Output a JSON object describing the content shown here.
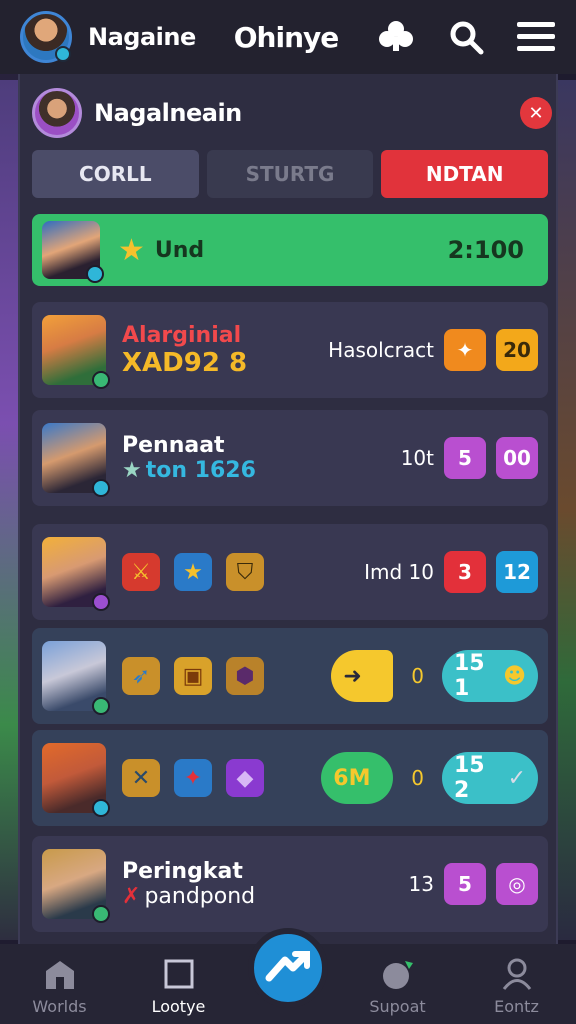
{
  "topbar": {
    "user_name": "Nagaine",
    "brand": "Ohinye",
    "icons": [
      "club-icon",
      "search-icon",
      "menu-icon"
    ]
  },
  "panel": {
    "title": "Nagalneain",
    "close_icon": "close-icon",
    "tabs": [
      {
        "label": "CORLL"
      },
      {
        "label": "STURTG"
      },
      {
        "label": "NDTAN"
      }
    ],
    "banner": {
      "label": "Und",
      "score": "2:100",
      "icon": "star-icon"
    },
    "rows": [
      {
        "title": "Alarginial",
        "subtitle": "XAD92 8",
        "side_label": "Hasolcract",
        "chips": [
          "✦",
          "20"
        ],
        "chip_colors": [
          "#f08a1e",
          "#f3a81a"
        ]
      },
      {
        "title": "Pennaat",
        "subtitle": "ton 1626",
        "side_label": "10t",
        "chips": [
          "5",
          "00"
        ],
        "chip_colors": [
          "#b94fd0",
          "#b94fd0"
        ]
      },
      {
        "side_label": "Imd 10",
        "chips": [
          "3",
          "12"
        ],
        "chip_colors": [
          "#e3303a",
          "#1e9ad8"
        ],
        "items": [
          "sword-icon",
          "star-icon",
          "shield-icon"
        ]
      },
      {
        "side_label": "0",
        "pill": "15 1",
        "items": [
          "bow-icon",
          "chest-icon",
          "crate-icon"
        ],
        "action_icon": "arrow-icon"
      },
      {
        "side_label": "0",
        "pill": "15 2",
        "action_label": "6M",
        "items": [
          "axe-icon",
          "bird-icon",
          "gem-icon"
        ]
      },
      {
        "title": "Peringkat",
        "subtitle": "pandpond",
        "side_label": "13",
        "chips": [
          "5",
          "◎"
        ],
        "chip_colors": [
          "#b94fd0",
          "#b94fd0"
        ]
      }
    ]
  },
  "bottom_nav": [
    {
      "label": "Worlds",
      "icon": "castle-icon"
    },
    {
      "label": "Lootye",
      "icon": "square-icon"
    },
    {
      "label": "Supoat",
      "icon": "planet-icon"
    },
    {
      "label": "Eontz",
      "icon": "profile-icon"
    }
  ],
  "fab_icon": "arrow-up-icon"
}
